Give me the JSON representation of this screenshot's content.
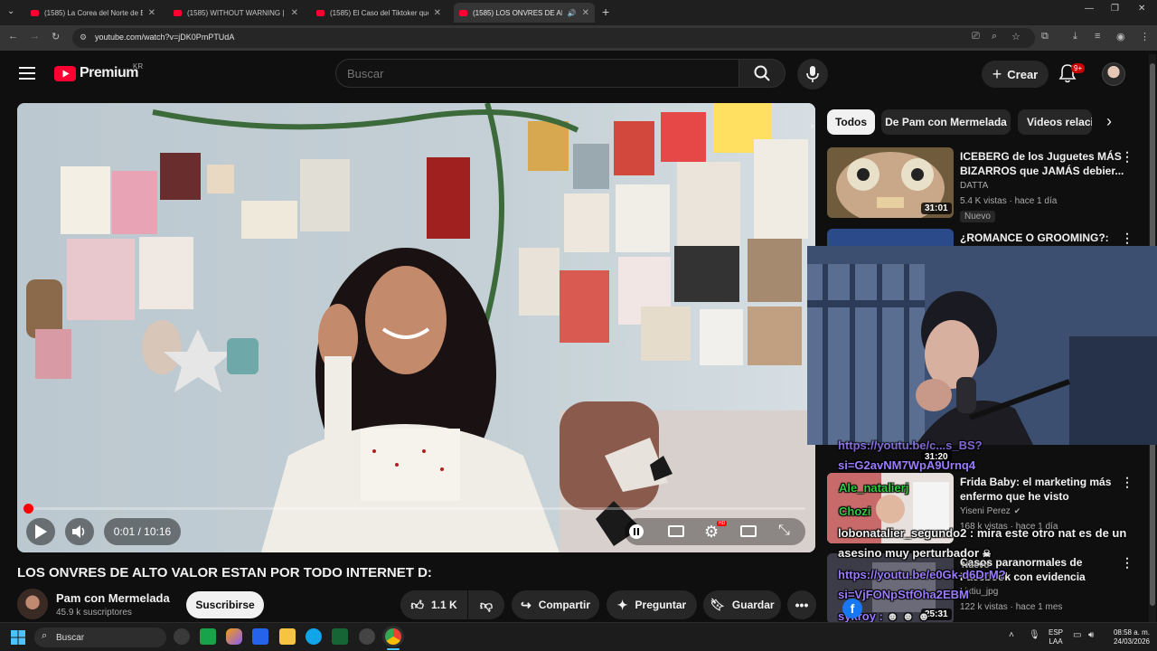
{
  "browser": {
    "tabs": [
      {
        "title": "(1585) La Corea del Norte de Es",
        "active": false
      },
      {
        "title": "(1585) WITHOUT WARNING | El",
        "active": false
      },
      {
        "title": "(1585) El Caso del Tiktoker que",
        "active": false
      },
      {
        "title": "(1585) LOS ONVRES DE ALT",
        "active": true
      }
    ],
    "url": "youtube.com/watch?v=jDK0PmPTUdA"
  },
  "header": {
    "logo_text": "Premium",
    "region": "KR",
    "search_placeholder": "Buscar",
    "create_label": "Crear",
    "notification_count": "9+"
  },
  "player": {
    "time": "0:01 / 10:16",
    "progress": 0.002
  },
  "video": {
    "title": "LOS ONVRES DE ALTO VALOR ESTAN POR TODO INTERNET D:",
    "channel": "Pam con Mermelada",
    "subscribers": "45.9 k suscriptores",
    "subscribe_label": "Suscribirse",
    "likes": "1.1 K",
    "share_label": "Compartir",
    "ask_label": "Preguntar",
    "save_label": "Guardar"
  },
  "chips": [
    "Todos",
    "De Pam con Mermelada",
    "Videos relacio"
  ],
  "recommendations": [
    {
      "title_line1": "ICEBERG de los Juguetes MÁS",
      "title_line2": "BIZARROS que JAMÁS debier...",
      "channel": "DATTA",
      "meta": "5.4 K vistas · hace 1 día",
      "duration": "31:01",
      "badge": "Nuevo"
    },
    {
      "title_line1": "¿ROMANCE O GROOMING?:"
    },
    {
      "title_line1": "Frida Baby: el marketing más",
      "title_line2": "enfermo que he visto",
      "channel": "Yiseni Perez",
      "meta": "168 k vistas · hace 1 día",
      "duration": "31:20"
    },
    {
      "title_line1": "Casos paranormales de",
      "title_line2": "Facebook con evidencia",
      "channel": "Lixtiu_jpg",
      "meta": "122 k vistas · hace 1 mes",
      "duration": "25:31"
    }
  ],
  "chat": [
    {
      "text": "https://youtu.be/c...s_BS?"
    },
    {
      "text": "si=G2avNM7WpA9Urnq4"
    },
    {
      "text": "Ale_natalierj"
    },
    {
      "text": "Chozi"
    },
    {
      "text": "lobonatalier_segundo2 : mira este otro nat es de un"
    },
    {
      "text": "asesino muy perturbador"
    },
    {
      "text": "https://youtu.be/e0Gk-d6DrM?"
    },
    {
      "text": "si=VjFONpStfOha2EBM"
    },
    {
      "text": "sykroy :"
    },
    {
      "text": "Nuevo"
    }
  ],
  "taskbar": {
    "search_label": "Buscar",
    "lang_line1": "ESP",
    "lang_line2": "LAA",
    "time": "08:58 a. m.",
    "date": "24/03/2026"
  },
  "colors": {
    "accent": "#ff0033",
    "chat_purple": "#9b7cff",
    "chat_green": "#2ecc40"
  }
}
